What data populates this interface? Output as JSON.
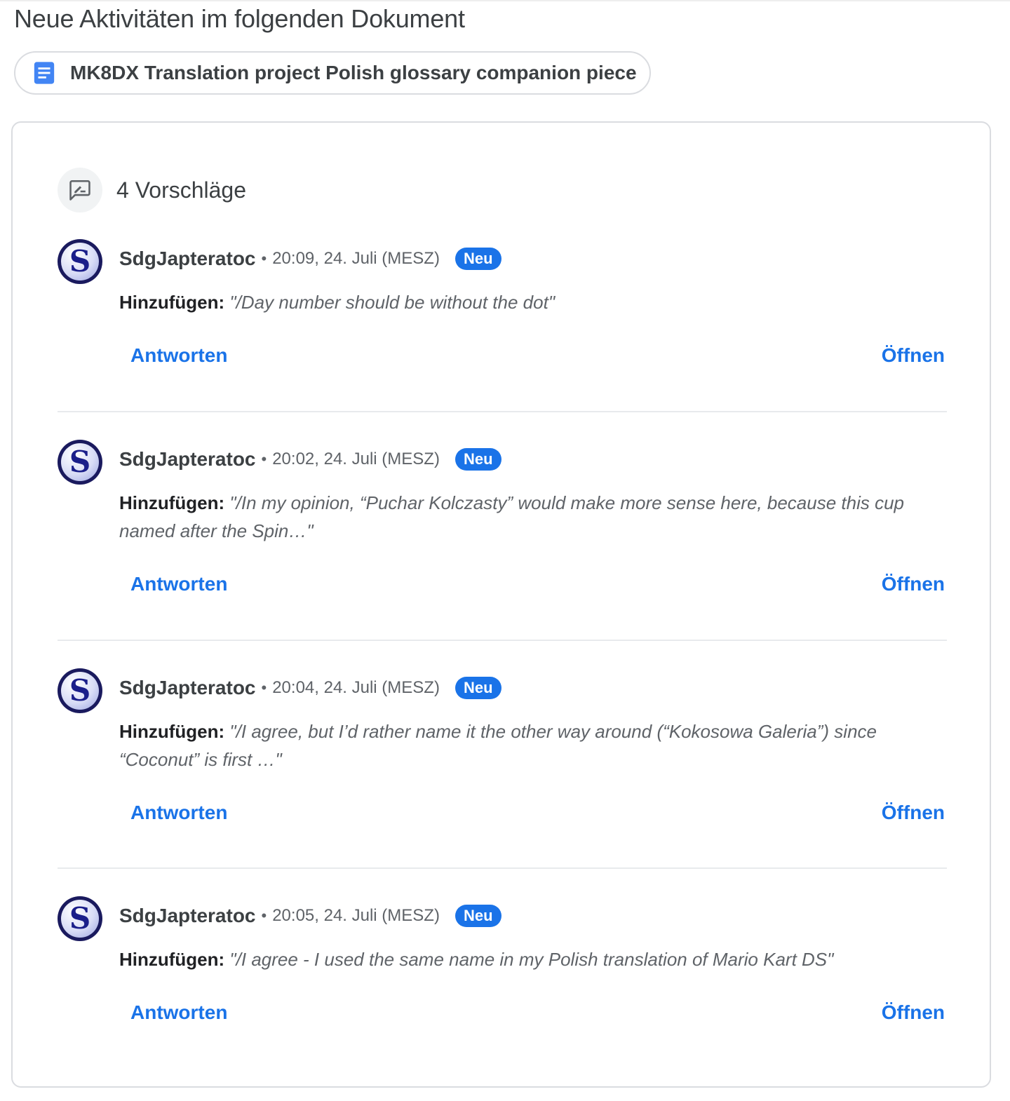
{
  "page": {
    "title": "Neue Aktivitäten im folgenden Dokument"
  },
  "document": {
    "name": "MK8DX Translation project Polish glossary companion piece",
    "icon": "google-docs-icon",
    "icon_color": "#4285F4"
  },
  "card": {
    "header_icon": "rate-review-icon",
    "title": "4 Vorschläge"
  },
  "colors": {
    "accent": "#1A73E8",
    "badge_bg": "#1A73E8",
    "border": "#DADCE0"
  },
  "suggestions": [
    {
      "avatar_letter": "S",
      "author": "SdgJapteratoc",
      "separator": "•",
      "time": "20:09, 24. Juli (MESZ)",
      "badge": "Neu",
      "action_label": "Hinzufügen:",
      "text": "\"/Day number should be without the dot\"",
      "reply_label": "Antworten",
      "open_label": "Öffnen"
    },
    {
      "avatar_letter": "S",
      "author": "SdgJapteratoc",
      "separator": "•",
      "time": "20:02, 24. Juli (MESZ)",
      "badge": "Neu",
      "action_label": "Hinzufügen:",
      "text": "\"/In my opinion, “Puchar Kolczasty” would make more sense here, because this cup named after the Spin…\"",
      "reply_label": "Antworten",
      "open_label": "Öffnen"
    },
    {
      "avatar_letter": "S",
      "author": "SdgJapteratoc",
      "separator": "•",
      "time": "20:04, 24. Juli (MESZ)",
      "badge": "Neu",
      "action_label": "Hinzufügen:",
      "text": "\"/I agree, but I’d rather name it the other way around (“Kokosowa Galeria”) since “Coconut” is first …\"",
      "reply_label": "Antworten",
      "open_label": "Öffnen"
    },
    {
      "avatar_letter": "S",
      "author": "SdgJapteratoc",
      "separator": "•",
      "time": "20:05, 24. Juli (MESZ)",
      "badge": "Neu",
      "action_label": "Hinzufügen:",
      "text": "\"/I agree - I used the same name in my Polish translation of Mario Kart DS\"",
      "reply_label": "Antworten",
      "open_label": "Öffnen"
    }
  ]
}
